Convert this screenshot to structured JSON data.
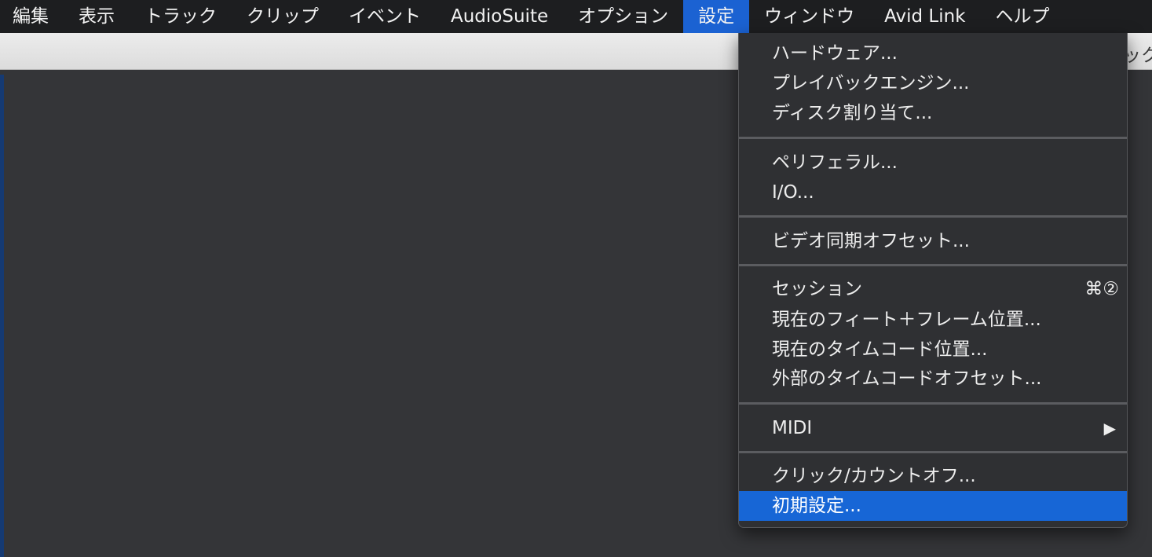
{
  "menubar": {
    "items": [
      "編集",
      "表示",
      "トラック",
      "クリップ",
      "イベント",
      "AudioSuite",
      "オプション",
      "設定",
      "ウィンドウ",
      "Avid Link",
      "ヘルプ"
    ],
    "active_item": "設定"
  },
  "toolbar": {
    "clipped_text": "ック"
  },
  "setup_menu": {
    "items": [
      {
        "label": "ハードウェア..."
      },
      {
        "label": "プレイバックエンジン..."
      },
      {
        "label": "ディスク割り当て..."
      },
      {
        "label": "ペリフェラル..."
      },
      {
        "label": "I/O..."
      },
      {
        "label": "ビデオ同期オフセット..."
      },
      {
        "label": "セッション",
        "shortcut": "⌘②"
      },
      {
        "label": "現在のフィート＋フレーム位置..."
      },
      {
        "label": "現在のタイムコード位置..."
      },
      {
        "label": "外部のタイムコードオフセット..."
      },
      {
        "label": "MIDI",
        "submenu_arrow": "▶"
      },
      {
        "label": "クリック/カウントオフ..."
      },
      {
        "label": "初期設定...",
        "highlighted": true
      }
    ]
  },
  "colors": {
    "menubar_bg": "#1d1e20",
    "active_menu": "#1b62d2",
    "menu_bg": "#2f3033",
    "highlight": "#1766d6",
    "workspace_bg": "#343538"
  }
}
